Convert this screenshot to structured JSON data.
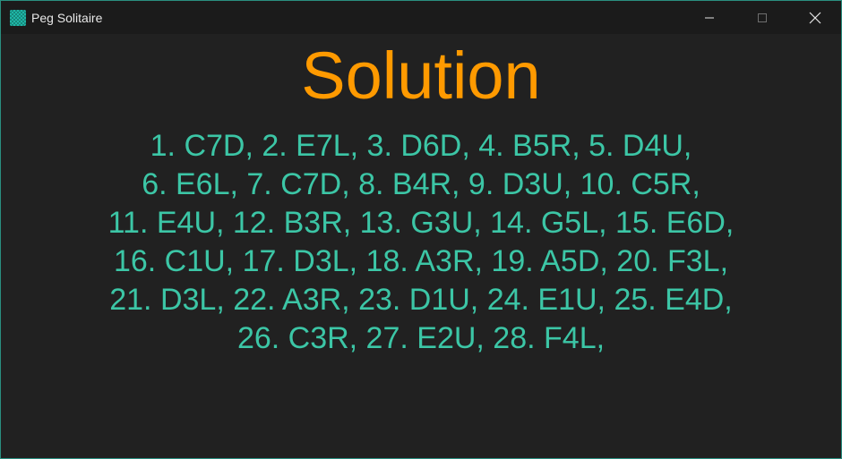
{
  "window": {
    "title": "Peg Solitaire",
    "icon": "peg-board-icon",
    "controls": {
      "minimize": "minimize-icon",
      "maximize": "maximize-icon",
      "close": "close-icon"
    }
  },
  "main": {
    "heading": "Solution",
    "lines": [
      "1. C7D, 2. E7L, 3. D6D, 4. B5R, 5. D4U,",
      "6. E6L, 7. C7D, 8. B4R, 9. D3U, 10. C5R,",
      "11. E4U, 12. B3R, 13. G3U, 14. G5L, 15. E6D,",
      "16. C1U, 17. D3L, 18. A3R, 19. A5D, 20. F3L,",
      "21. D3L, 22. A3R, 23. D1U, 24. E1U, 25. E4D,",
      "26. C3R, 27. E2U, 28. F4L,"
    ]
  },
  "colors": {
    "heading": "#ff9a00",
    "solution_text": "#3cc6a6",
    "background": "#212121",
    "titlebar": "#1b1b1b"
  }
}
